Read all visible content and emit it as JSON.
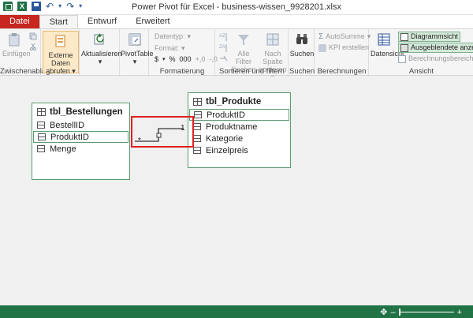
{
  "window": {
    "title": "Power Pivot für Excel - business-wissen_9928201.xlsx"
  },
  "tabs": [
    "Datei",
    "Start",
    "Entwurf",
    "Erweitert"
  ],
  "ribbon": {
    "clipboard": {
      "paste": "Einfügen",
      "group": "Zwischenablage"
    },
    "external": {
      "line1": "Externe Daten",
      "line2": "abrufen"
    },
    "refresh": "Aktualisieren",
    "pivot": "PivotTable",
    "formatting": {
      "datatype": "Datentyp:",
      "format": "Format:",
      "currency": "$",
      "percent": "%",
      "thousands": "000",
      "dec_inc": "+,0",
      "dec_dec": "-,0",
      "group": "Formatierung"
    },
    "sort": {
      "clear": "Alle Filter löschen",
      "sortcol": "Nach Spalte sortieren",
      "group": "Sortieren und filtern"
    },
    "find": {
      "label": "Suchen",
      "group": "Suchen"
    },
    "calc": {
      "autosum": "AutoSumme",
      "kpi": "KPI erstellen",
      "group": "Berechnungen"
    },
    "view": {
      "dataview": "Datensicht",
      "diagram": "Diagrammsicht",
      "hidden": "Ausgeblendete anzeigen",
      "calcarea": "Berechnungsbereich",
      "group": "Ansicht"
    }
  },
  "diagram": {
    "tables": [
      {
        "name": "tbl_Bestellungen",
        "columns": [
          "BestellID",
          "ProduktID",
          "Menge"
        ],
        "selected": "ProduktID"
      },
      {
        "name": "tbl_Produkte",
        "columns": [
          "ProduktID",
          "Produktname",
          "Kategorie",
          "Einzelpreis"
        ],
        "selected": "ProduktID"
      }
    ],
    "relationship": {
      "many_label": "*",
      "one_label": "1"
    }
  },
  "colors": {
    "accent": "#217346",
    "highlight": "#e02020",
    "file_tab": "#c7271f"
  }
}
